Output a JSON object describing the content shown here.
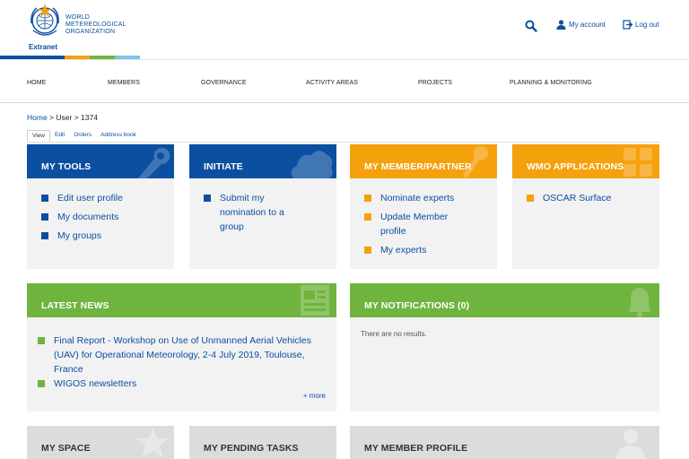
{
  "header": {
    "org_line1": "WORLD",
    "org_line2": "METEREOLOGICAL",
    "org_line3": "ORGANIZATION",
    "extranet": "Extranet",
    "my_account": "My account",
    "log_out": "Log out"
  },
  "colors": {
    "brand_blue": "#0b4fa1",
    "orange": "#f5a00d",
    "green": "#6fb43f",
    "light_blue": "#7ec4e6",
    "grey_head": "#dcdcdc"
  },
  "nav": {
    "items": [
      "HOME",
      "MEMBERS",
      "GOVERNANCE",
      "ACTIVITY AREAS",
      "PROJECTS",
      "PLANNING & MONITORING"
    ]
  },
  "breadcrumb": {
    "home": "Home",
    "sep1": " > ",
    "user": "User",
    "sep2": " > ",
    "id": "1374"
  },
  "tabs": [
    "View",
    "Edit",
    "Orders",
    "Address book"
  ],
  "cards": {
    "my_tools": {
      "title": "MY TOOLS",
      "items": [
        "Edit user profile",
        "My documents",
        "My groups"
      ]
    },
    "initiate": {
      "title": "INITIATE",
      "items": [
        "Submit my nomination to a group"
      ]
    },
    "member_partner": {
      "title": "MY MEMBER/PARTNER",
      "items": [
        "Nominate experts",
        "Update Member profile",
        "My experts"
      ]
    },
    "wmo_apps": {
      "title": "WMO APPLICATIONS",
      "items": [
        "OSCAR Surface"
      ]
    },
    "latest_news": {
      "title": "LATEST NEWS",
      "items": [
        "Final Report - Workshop on Use of Unmanned Aerial Vehicles (UAV) for Operational Meteorology, 2-4 July 2019, Toulouse, France",
        "WIGOS newsletters"
      ],
      "more": "+ more"
    },
    "notifications": {
      "title": "MY NOTIFICATIONS (0)",
      "empty": "There are no results."
    },
    "my_space": {
      "title": "MY SPACE"
    },
    "pending_tasks": {
      "title": "MY PENDING TASKS"
    },
    "member_profile": {
      "title": "MY MEMBER PROFILE"
    }
  }
}
